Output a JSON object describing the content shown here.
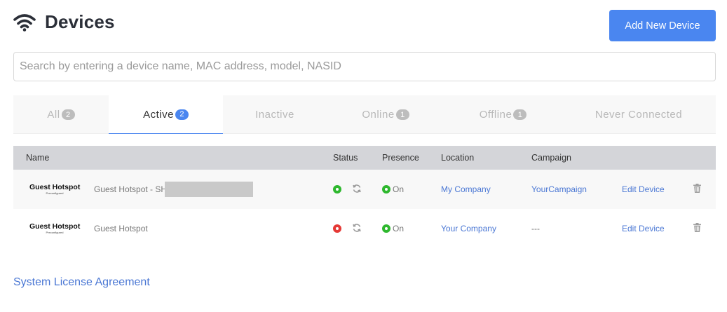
{
  "header": {
    "title": "Devices",
    "add_button_label": "Add New Device"
  },
  "search": {
    "placeholder": "Search by entering a device name, MAC address, model, NASID",
    "value": ""
  },
  "tabs": [
    {
      "label": "All",
      "count": "2",
      "active": false
    },
    {
      "label": "Active",
      "count": "2",
      "active": true
    },
    {
      "label": "Inactive",
      "count": "",
      "active": false
    },
    {
      "label": "Online",
      "count": "1",
      "active": false
    },
    {
      "label": "Offline",
      "count": "1",
      "active": false
    },
    {
      "label": "Never Connected",
      "count": "",
      "active": false
    }
  ],
  "table": {
    "columns": {
      "name": "Name",
      "status": "Status",
      "presence": "Presence",
      "location": "Location",
      "campaign": "Campaign"
    },
    "rows": [
      {
        "brand": "Guest Hotspot",
        "brand_sub": "Preconfigured",
        "device_name": "Guest Hotspot - SH50",
        "status_color": "#2eb82e",
        "presence": "On",
        "presence_color": "#2eb82e",
        "location": "My Company",
        "campaign": "YourCampaign",
        "edit_label": "Edit Device"
      },
      {
        "brand": "Guest Hotspot",
        "brand_sub": "Preconfigured",
        "device_name": "Guest Hotspot",
        "status_color": "#e53935",
        "presence": "On",
        "presence_color": "#2eb82e",
        "location": "Your Company",
        "campaign": "---",
        "edit_label": "Edit Device"
      }
    ]
  },
  "footer": {
    "license_link": "System License Agreement"
  },
  "colors": {
    "accent": "#4a86f0",
    "link": "#4a77d4",
    "online": "#2eb82e",
    "offline": "#e53935"
  }
}
